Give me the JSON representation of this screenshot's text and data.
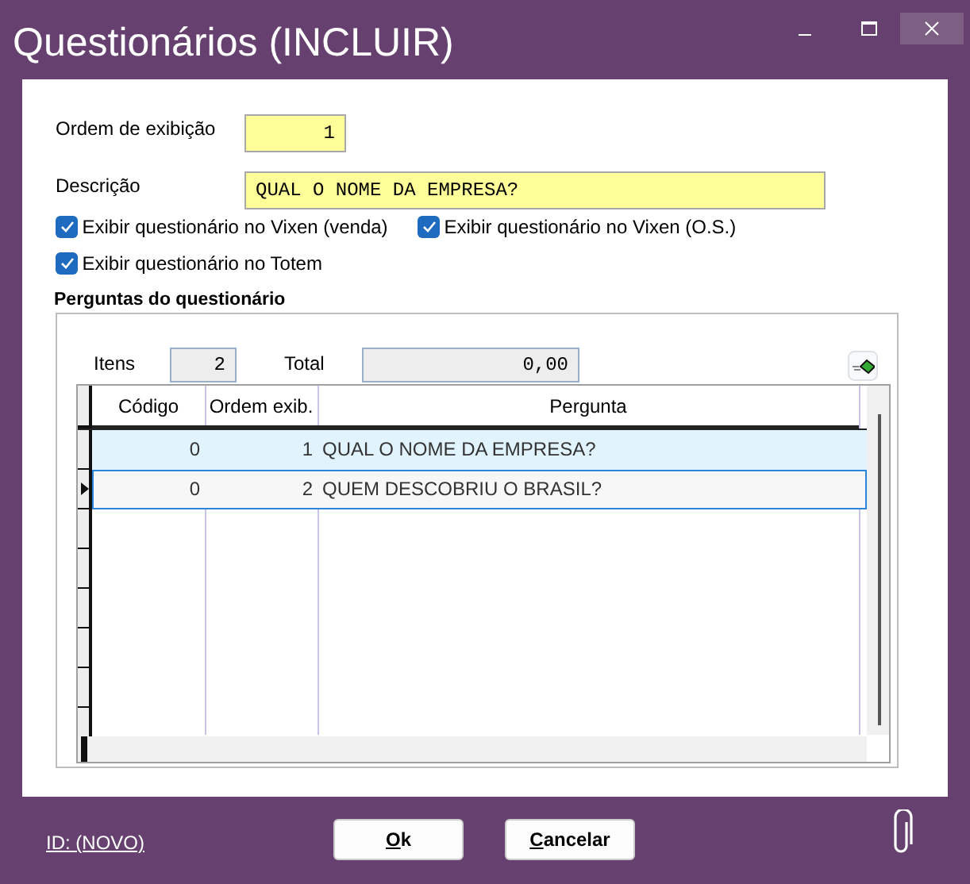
{
  "window": {
    "title": "Questionários (INCLUIR)"
  },
  "form": {
    "order_label": "Ordem de exibição",
    "order_value": "1",
    "description_label": "Descrição",
    "description_value": "QUAL O NOME DA EMPRESA?",
    "checkboxes": [
      {
        "label": "Exibir questionário no Vixen (venda)",
        "checked": true
      },
      {
        "label": "Exibir questionário no Vixen (O.S.)",
        "checked": true
      },
      {
        "label": "Exibir questionário no Totem",
        "checked": true
      }
    ]
  },
  "questions": {
    "title": "Perguntas do questionário",
    "items_label": "Itens",
    "items_value": "2",
    "total_label": "Total",
    "total_value": "0,00",
    "columns": [
      "Código",
      "Ordem exib.",
      "Pergunta"
    ],
    "rows": [
      {
        "cells": [
          "0",
          "1",
          "QUAL O NOME DA EMPRESA?"
        ],
        "hovered": true,
        "selected": false
      },
      {
        "cells": [
          "0",
          "2",
          "QUEM DESCOBRIU O BRASIL?"
        ],
        "hovered": false,
        "selected": true
      }
    ]
  },
  "footer": {
    "id_link": "ID: (NOVO)",
    "buttons": [
      {
        "label": "Ok"
      },
      {
        "label": "Cancelar"
      }
    ]
  }
}
